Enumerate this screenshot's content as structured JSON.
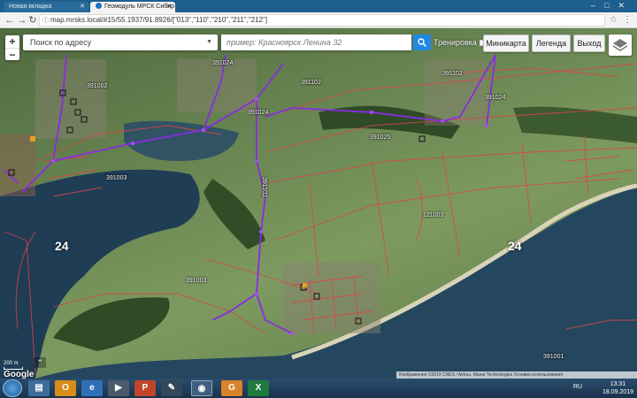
{
  "browser": {
    "tabs": [
      {
        "title": "Новая вкладка",
        "active": false
      },
      {
        "title": "Геомодуль МРСК Сибир",
        "active": true
      }
    ],
    "url": "map.mrsks.local/#15/55.1937/91.8926/[\"013\",\"110\",\"210\",\"211\",\"212\"]"
  },
  "toolbar": {
    "search_placeholder": "Поиск по адресу",
    "example": "пример: Красноярск Ленина 32",
    "training_label": "Тренировка",
    "minimap_label": "Миникарта",
    "legend_label": "Легенда",
    "exit_label": "Выход"
  },
  "map": {
    "zoom_in": "+",
    "zoom_out": "−",
    "sector_labels": [
      "24",
      "24"
    ],
    "parcel_labels": [
      "391002",
      "391024",
      "391102",
      "391024",
      "391025",
      "391024",
      "391003",
      "391102",
      "121003",
      "391003",
      "391001",
      "391102"
    ],
    "scale_text": "200 m",
    "google": "Google",
    "attribution": "Изображения ©2019 CNES / Airbus, Maxar Technologies   Условия использования"
  },
  "taskbar": {
    "lang": "RU",
    "time": "13:31",
    "date": "18.09.2019",
    "apps": [
      "explorer",
      "outlook",
      "ie",
      "media",
      "ppt",
      "chrome",
      "app",
      "excel"
    ]
  }
}
